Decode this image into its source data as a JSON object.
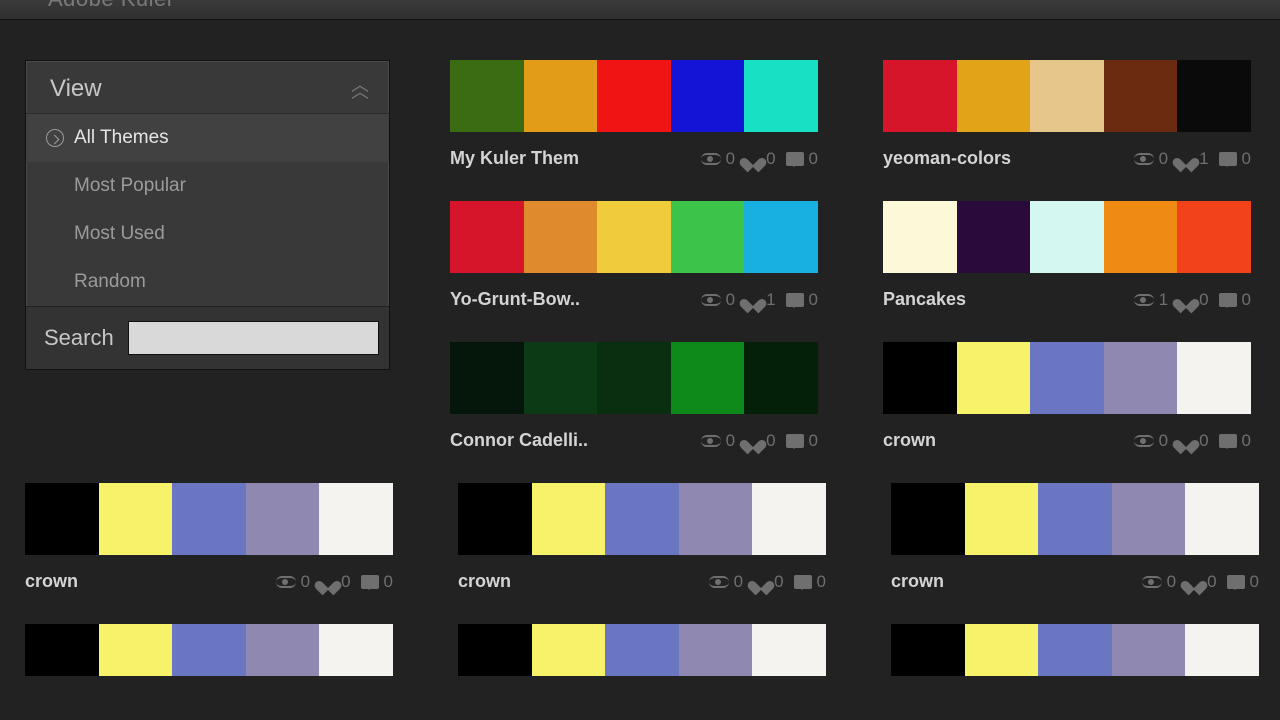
{
  "app_title": "Adobe Kuler",
  "sidebar": {
    "panel_title": "View",
    "items": [
      {
        "label": "All Themes",
        "active": true
      },
      {
        "label": "Most Popular",
        "active": false
      },
      {
        "label": "Most Used",
        "active": false
      },
      {
        "label": "Random",
        "active": false
      }
    ],
    "search_label": "Search",
    "search_placeholder": ""
  },
  "themes_top": [
    {
      "name": "My Kuler Them",
      "views": 0,
      "likes": 0,
      "comments": 0,
      "colors": [
        "#3b6b12",
        "#e29c18",
        "#f01414",
        "#1414d6",
        "#18e0c4"
      ]
    },
    {
      "name": "yeoman-colors",
      "views": 0,
      "likes": 1,
      "comments": 0,
      "colors": [
        "#d6152b",
        "#e3a318",
        "#e6c68a",
        "#6b2b10",
        "#0a0a0a"
      ]
    },
    {
      "name": "Yo-Grunt-Bow..",
      "views": 0,
      "likes": 1,
      "comments": 0,
      "colors": [
        "#d6152b",
        "#e08a2e",
        "#f0cc3c",
        "#3cc44a",
        "#18b0e0"
      ]
    },
    {
      "name": "Pancakes",
      "views": 1,
      "likes": 0,
      "comments": 0,
      "colors": [
        "#fbf9d8",
        "#2a0a3a",
        "#d4f7f2",
        "#ef8a12",
        "#f2421a"
      ]
    },
    {
      "name": "Connor Cadelli..",
      "views": 0,
      "likes": 0,
      "comments": 0,
      "colors": [
        "#05160a",
        "#0c3a14",
        "#0a2e10",
        "#0e8a1a",
        "#052008"
      ]
    },
    {
      "name": "crown",
      "views": 0,
      "likes": 0,
      "comments": 0,
      "colors": [
        "#000000",
        "#f6f26a",
        "#6a76c2",
        "#8f88b0",
        "#f5f3f0"
      ]
    }
  ],
  "themes_full": [
    {
      "name": "crown",
      "views": 0,
      "likes": 0,
      "comments": 0,
      "colors": [
        "#000000",
        "#f6f26a",
        "#6a76c2",
        "#8f88b0",
        "#f5f3f0"
      ]
    },
    {
      "name": "crown",
      "views": 0,
      "likes": 0,
      "comments": 0,
      "colors": [
        "#000000",
        "#f6f26a",
        "#6a76c2",
        "#8f88b0",
        "#f5f3f0"
      ]
    },
    {
      "name": "crown",
      "views": 0,
      "likes": 0,
      "comments": 0,
      "colors": [
        "#000000",
        "#f6f26a",
        "#6a76c2",
        "#8f88b0",
        "#f5f3f0"
      ]
    },
    {
      "name": "",
      "views": "",
      "likes": "",
      "comments": "",
      "colors": [
        "#000000",
        "#f6f26a",
        "#6a76c2",
        "#8f88b0",
        "#f5f3f0"
      ]
    },
    {
      "name": "",
      "views": "",
      "likes": "",
      "comments": "",
      "colors": [
        "#000000",
        "#f6f26a",
        "#6a76c2",
        "#8f88b0",
        "#f5f3f0"
      ]
    },
    {
      "name": "",
      "views": "",
      "likes": "",
      "comments": "",
      "colors": [
        "#000000",
        "#f6f26a",
        "#6a76c2",
        "#8f88b0",
        "#f5f3f0"
      ]
    }
  ]
}
